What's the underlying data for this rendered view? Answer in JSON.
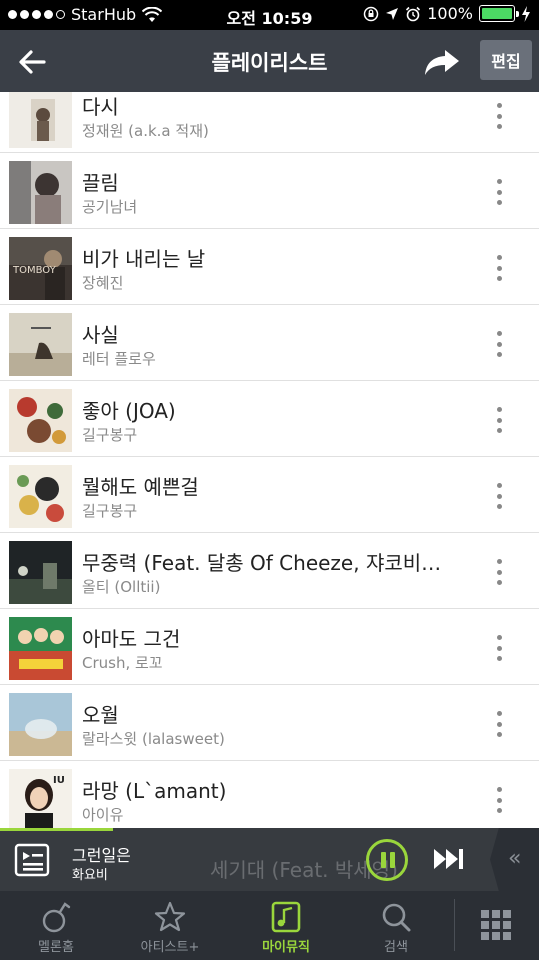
{
  "status_bar": {
    "carrier": "StarHub",
    "time": "오전 10:59",
    "battery": "100%",
    "battery_level": 1.0
  },
  "header": {
    "title": "플레이리스트",
    "edit_label": "편집"
  },
  "playlist": [
    {
      "title": "다시",
      "artist": "정재원 (a.k.a 적재)"
    },
    {
      "title": "끌림",
      "artist": "공기남녀"
    },
    {
      "title": "비가 내리는 날",
      "artist": "장혜진",
      "art_text": "TOMBOY"
    },
    {
      "title": "사실",
      "artist": "레터 플로우"
    },
    {
      "title": "좋아 (JOA)",
      "artist": "길구봉구"
    },
    {
      "title": "뭘해도 예쁜걸",
      "artist": "길구봉구"
    },
    {
      "title": "무중력 (Feat. 달총 Of Cheeze, 쟈코비…",
      "artist": "올티 (Olltii)"
    },
    {
      "title": "아마도 그건",
      "artist": "Crush, 로꼬"
    },
    {
      "title": "오월",
      "artist": "랄라스윗 (lalasweet)"
    },
    {
      "title": "라망 (L`amant)",
      "artist": "아이유",
      "art_text": "IU"
    }
  ],
  "mini_player": {
    "title": "그런일은",
    "artist": "화요비",
    "background_title": "세기대 (Feat. 박세영)",
    "progress": 0.21,
    "collapse_glyph": "«"
  },
  "tabs": [
    {
      "label": "멜론홈",
      "icon": "melon-icon",
      "active": false
    },
    {
      "label": "아티스트+",
      "icon": "star-icon",
      "active": false
    },
    {
      "label": "마이뮤직",
      "icon": "music-note-icon",
      "active": true
    },
    {
      "label": "검색",
      "icon": "search-icon",
      "active": false
    }
  ],
  "colors": {
    "accent": "#9ad63c",
    "header_bg": "#3a3f47",
    "tabbar_bg": "#2b2f35"
  }
}
